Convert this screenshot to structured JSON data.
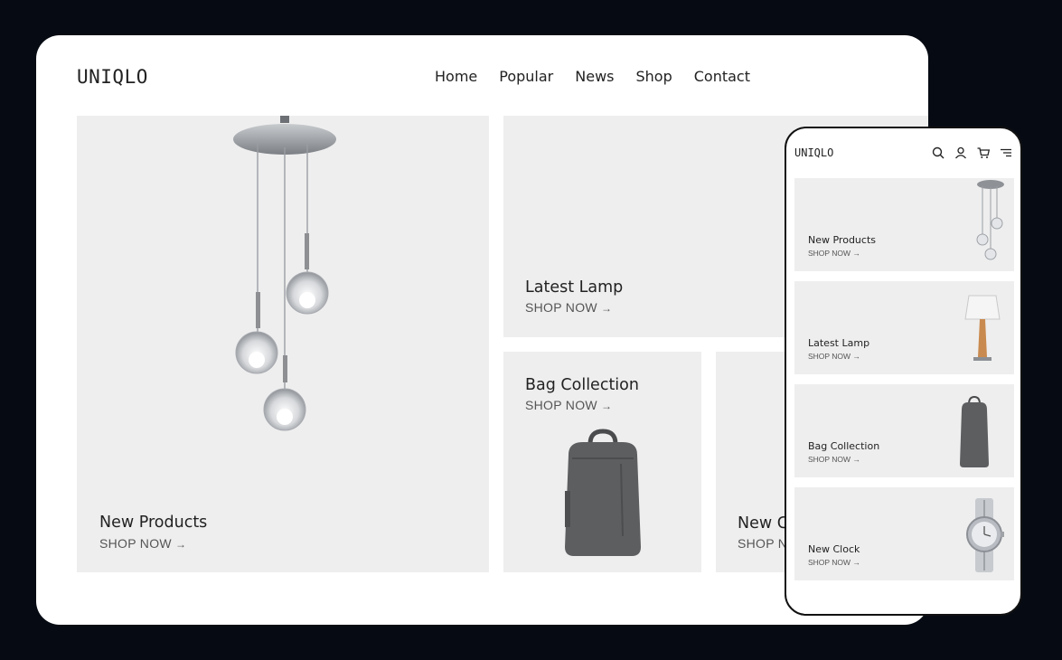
{
  "desktop": {
    "logo": "UNIQLO",
    "nav": [
      "Home",
      "Popular",
      "News",
      "Shop",
      "Contact"
    ],
    "tiles": [
      {
        "title": "New Products",
        "cta": "SHOP NOW"
      },
      {
        "title": "Latest Lamp",
        "cta": "SHOP NOW"
      },
      {
        "title": "Bag Collection",
        "cta": "SHOP NOW"
      },
      {
        "title": "New Clock",
        "cta": "SHOP NOW"
      }
    ]
  },
  "mobile": {
    "logo": "UNIQLO",
    "icons": [
      "search-icon",
      "user-icon",
      "cart-icon",
      "menu-icon"
    ],
    "tiles": [
      {
        "title": "New Products",
        "cta": "SHOP NOW"
      },
      {
        "title": "Latest Lamp",
        "cta": "SHOP NOW"
      },
      {
        "title": "Bag Collection",
        "cta": "SHOP NOW"
      },
      {
        "title": "New Clock",
        "cta": "SHOP NOW"
      }
    ]
  },
  "colors": {
    "background": "#060b13",
    "card": "#ffffff",
    "tile": "#eeeeee",
    "text": "#222222"
  }
}
